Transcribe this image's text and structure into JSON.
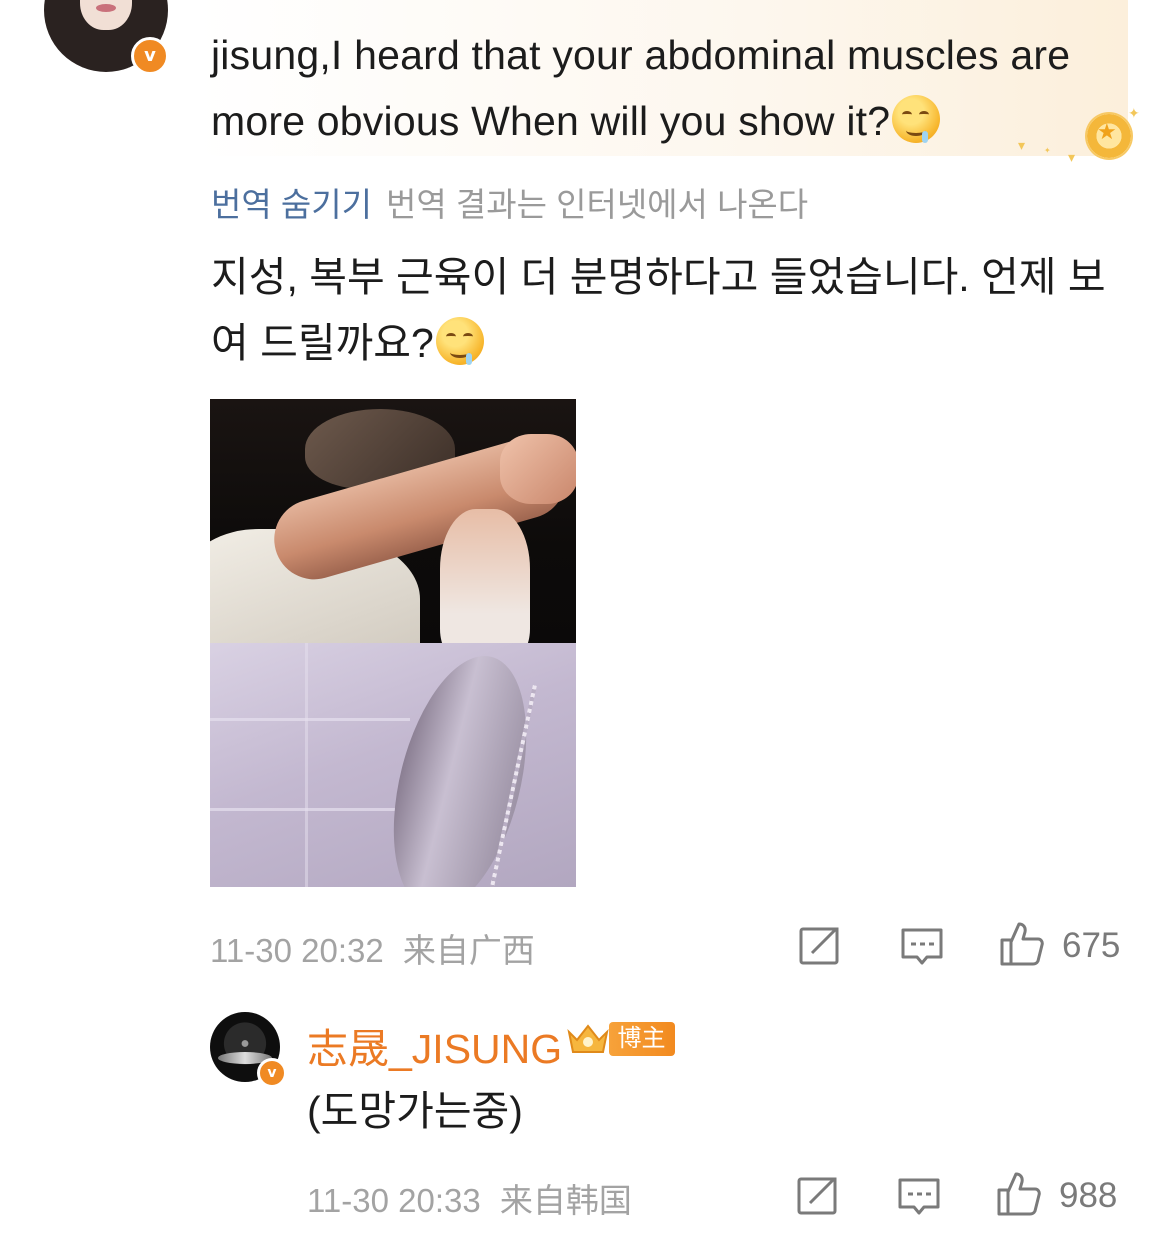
{
  "comment": {
    "text_en": "jisung,I heard that your abdominal muscles are more obvious When will you show it?",
    "emoji": "drooling-face",
    "verified_badge": "v",
    "translation": {
      "hide_label": "번역 숨기기",
      "source_note": "번역 결과는 인터넷에서 나온다",
      "text_ko": "지성, 복부 근육이 더 분명하다고 들었습니다. 언제 보여 드릴까요?"
    },
    "timestamp": "11-30 20:32",
    "location": "来自广西",
    "like_count": "675"
  },
  "reply": {
    "author": "志晟_JISUNG",
    "badge_label": "博主",
    "verified_badge": "v",
    "text": "(도망가는중)",
    "timestamp": "11-30 20:33",
    "location": "来自韩国",
    "like_count": "988"
  },
  "colors": {
    "author_name": "#eb7a24",
    "link_blue": "#4c6f9e",
    "meta_gray": "#a3a3a3",
    "badge_orange": "#f08a23"
  },
  "icons": [
    "share-icon",
    "comment-icon",
    "like-icon"
  ]
}
